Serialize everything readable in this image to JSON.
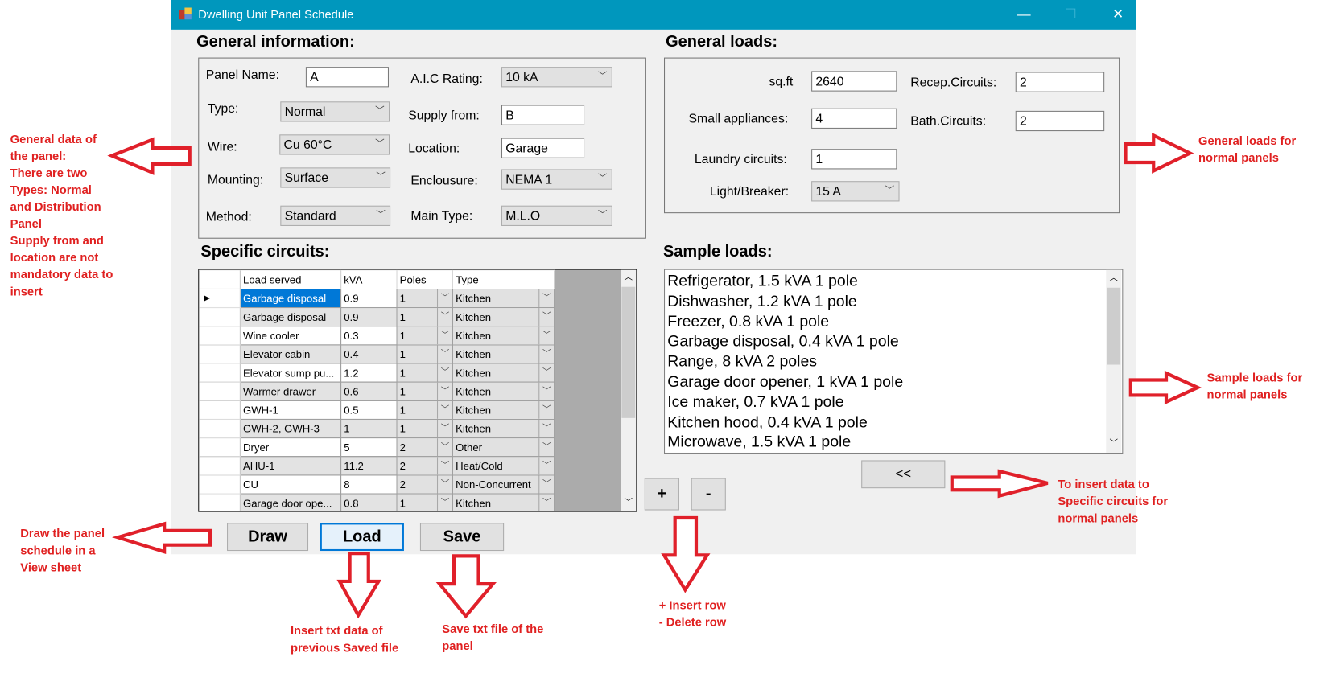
{
  "window": {
    "title": "Dwelling Unit Panel Schedule",
    "minimize": "—",
    "maximize": "☐",
    "close": "✕"
  },
  "general_info": {
    "heading": "General information:",
    "panel_name": {
      "label": "Panel Name:",
      "value": "A"
    },
    "aic_rating": {
      "label": "A.I.C Rating:",
      "value": "10 kA"
    },
    "type": {
      "label": "Type:",
      "value": "Normal"
    },
    "supply_from": {
      "label": "Supply from:",
      "value": "B"
    },
    "wire": {
      "label": "Wire:",
      "value": "Cu 60°C"
    },
    "location": {
      "label": "Location:",
      "value": "Garage"
    },
    "mounting": {
      "label": "Mounting:",
      "value": "Surface"
    },
    "enclosure": {
      "label": "Enclousure:",
      "value": "NEMA 1"
    },
    "method": {
      "label": "Method:",
      "value": "Standard"
    },
    "main_type": {
      "label": "Main Type:",
      "value": "M.L.O"
    }
  },
  "general_loads": {
    "heading": "General loads:",
    "sqft": {
      "label": "sq.ft",
      "value": "2640"
    },
    "recep_circuits": {
      "label": "Recep.Circuits:",
      "value": "2"
    },
    "small_appliances": {
      "label": "Small appliances:",
      "value": "4"
    },
    "bath_circuits": {
      "label": "Bath.Circuits:",
      "value": "2"
    },
    "laundry_circuits": {
      "label": "Laundry circuits:",
      "value": "1"
    },
    "light_breaker": {
      "label": "Light/Breaker:",
      "value": "15 A"
    }
  },
  "specific_circuits": {
    "heading": "Specific circuits:",
    "columns": [
      "Load served",
      "kVA",
      "Poles",
      "Type"
    ],
    "rows": [
      {
        "load": "Garbage disposal",
        "kva": "0.9",
        "poles": "1",
        "type": "Kitchen"
      },
      {
        "load": "Garbage disposal",
        "kva": "0.9",
        "poles": "1",
        "type": "Kitchen"
      },
      {
        "load": "Wine cooler",
        "kva": "0.3",
        "poles": "1",
        "type": "Kitchen"
      },
      {
        "load": "Elevator cabin",
        "kva": "0.4",
        "poles": "1",
        "type": "Kitchen"
      },
      {
        "load": "Elevator sump pu...",
        "kva": "1.2",
        "poles": "1",
        "type": "Kitchen"
      },
      {
        "load": "Warmer drawer",
        "kva": "0.6",
        "poles": "1",
        "type": "Kitchen"
      },
      {
        "load": "GWH-1",
        "kva": "0.5",
        "poles": "1",
        "type": "Kitchen"
      },
      {
        "load": "GWH-2, GWH-3",
        "kva": "1",
        "poles": "1",
        "type": "Kitchen"
      },
      {
        "load": "Dryer",
        "kva": "5",
        "poles": "2",
        "type": "Other"
      },
      {
        "load": "AHU-1",
        "kva": "11.2",
        "poles": "2",
        "type": "Heat/Cold"
      },
      {
        "load": "CU",
        "kva": "8",
        "poles": "2",
        "type": "Non-Concurrent"
      },
      {
        "load": "Garage door ope...",
        "kva": "0.8",
        "poles": "1",
        "type": "Kitchen"
      }
    ]
  },
  "sample_loads": {
    "heading": "Sample loads:",
    "items": [
      "Refrigerator, 1.5 kVA 1 pole",
      "Dishwasher, 1.2 kVA 1 pole",
      "Freezer, 0.8 kVA 1 pole",
      "Garbage disposal, 0.4 kVA 1 pole",
      "Range, 8 kVA 2 poles",
      "Garage door opener, 1 kVA 1 pole",
      "Ice maker, 0.7 kVA 1 pole",
      "Kitchen hood, 0.4 kVA 1 pole",
      "Microwave, 1.5 kVA 1 pole"
    ]
  },
  "buttons": {
    "insert": "<<",
    "add_row": "+",
    "delete_row": "-",
    "draw": "Draw",
    "load": "Load",
    "save": "Save"
  },
  "annotations": {
    "general_data": [
      "General data of",
      "the panel:",
      "There are two",
      "Types: Normal",
      "and Distribution",
      "Panel",
      " Supply from and",
      " location are not",
      " mandatory data to",
      " insert"
    ],
    "general_loads": [
      "General loads for",
      "normal panels"
    ],
    "sample_loads": [
      "Sample loads for",
      "normal panels"
    ],
    "insert_data": [
      "To insert data to",
      "Specific circuits for",
      "normal panels"
    ],
    "draw": [
      "Draw the panel",
      "schedule in a",
      "View sheet"
    ],
    "load": [
      "Insert txt data of",
      "previous Saved file"
    ],
    "save": [
      "Save txt file of the",
      "panel"
    ],
    "rows": [
      "+ Insert row",
      "- Delete row"
    ]
  }
}
